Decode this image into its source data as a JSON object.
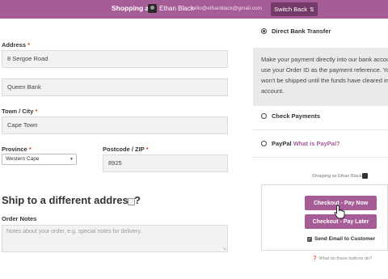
{
  "admin_bar": {
    "shopping_as": "Shopping as",
    "user_name": "Ethan Black",
    "user_email": "hello@ethanblack@gmail.com",
    "switch_back": "Switch Back",
    "switch_icon": "shuffle-icon",
    "accent_color": "#a65c97"
  },
  "billing": {
    "address_label": "Address",
    "address_1": "8 Sergoe Road",
    "address_2": "Queen Bank",
    "city_label": "Town / City",
    "city": "Cape Town",
    "province_label": "Province",
    "province": "Western Cape",
    "postcode_label": "Postcode / ZIP",
    "postcode": "8925",
    "required_mark": "*"
  },
  "shipping": {
    "title": "Ship to a different address?"
  },
  "order_notes": {
    "label": "Order Notes",
    "placeholder": "Notes about your order, e.g. special notes for delivery."
  },
  "payment": {
    "methods": [
      {
        "label": "Direct Bank Transfer",
        "selected": true
      },
      {
        "label": "Check Payments",
        "selected": false
      },
      {
        "label": "PayPal",
        "link": "What is PayPal?",
        "selected": false
      }
    ],
    "description_lines": [
      "Make your payment directly into our bank account. Please",
      "use your Order ID as the payment reference. Your order",
      "won't be shipped until the funds have cleared in our",
      "account."
    ]
  },
  "checkout_box": {
    "shopping_as": "Shopping as Ethan Black",
    "pay_now": "Checkout - Pay Now",
    "pay_later": "Checkout - Pay Later",
    "send_email": "Send Email to Customer",
    "send_email_checked": true,
    "what_link": "What do these buttons do?"
  }
}
